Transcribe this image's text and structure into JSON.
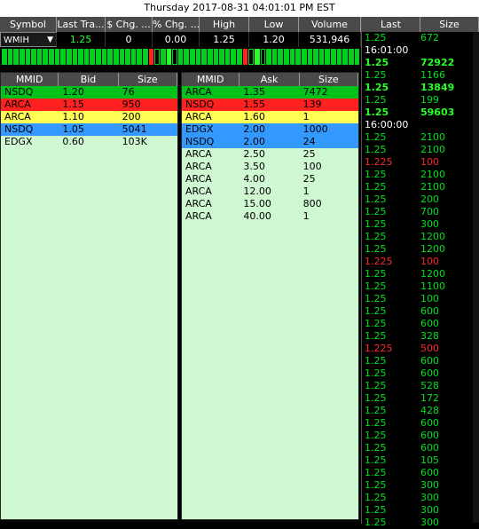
{
  "window_title": "Thursday 2017-08-31 04:01:01 PM EST",
  "quote": {
    "headers": [
      "Symbol",
      "Last Tra...",
      "$ Chg. ...",
      "% Chg. ...",
      "High",
      "Low",
      "Volume"
    ],
    "symbol": "WMIH",
    "last": "1.25",
    "chg": "0",
    "pct_chg": "0.00",
    "high": "1.25",
    "low": "1.20",
    "volume": "531,946"
  },
  "ticks": [
    "g",
    "g",
    "g",
    "g",
    "g",
    "g",
    "g",
    "g",
    "g",
    "g",
    "g",
    "g",
    "g",
    "g",
    "g",
    "g",
    "g",
    "g",
    "g",
    "g",
    "g",
    "g",
    "g",
    "g",
    "g",
    "r",
    "e",
    "g",
    "lg",
    "e",
    "g",
    "g",
    "g",
    "g",
    "g",
    "g",
    "g",
    "g",
    "g",
    "g",
    "g",
    "r",
    "e",
    "lg",
    "e",
    "g",
    "g",
    "g",
    "g",
    "g",
    "g",
    "g",
    "g",
    "g",
    "g",
    "g",
    "g",
    "g",
    "g",
    "g",
    "g"
  ],
  "bid_book": {
    "headers": [
      "MMID",
      "Bid",
      "Size"
    ],
    "rows": [
      {
        "mmid": "NSDQ",
        "price": "1.20",
        "size": "76",
        "bg": "#00c21a"
      },
      {
        "mmid": "ARCA",
        "price": "1.15",
        "size": "950",
        "bg": "#ff2020"
      },
      {
        "mmid": "ARCA",
        "price": "1.10",
        "size": "200",
        "bg": "#ffff55"
      },
      {
        "mmid": "NSDQ",
        "price": "1.05",
        "size": "5041",
        "bg": "#3399ff"
      },
      {
        "mmid": "EDGX",
        "price": "0.60",
        "size": "103K",
        "bg": "#cff7d2"
      }
    ]
  },
  "ask_book": {
    "headers": [
      "MMID",
      "Ask",
      "Size"
    ],
    "rows": [
      {
        "mmid": "ARCA",
        "price": "1.35",
        "size": "7472",
        "bg": "#00c21a"
      },
      {
        "mmid": "NSDQ",
        "price": "1.55",
        "size": "139",
        "bg": "#ff2020"
      },
      {
        "mmid": "ARCA",
        "price": "1.60",
        "size": "1",
        "bg": "#ffff55"
      },
      {
        "mmid": "EDGX",
        "price": "2.00",
        "size": "1000",
        "bg": "#3399ff"
      },
      {
        "mmid": "NSDQ",
        "price": "2.00",
        "size": "24",
        "bg": "#3399ff"
      },
      {
        "mmid": "ARCA",
        "price": "2.50",
        "size": "25",
        "bg": "#cff7d2"
      },
      {
        "mmid": "ARCA",
        "price": "3.50",
        "size": "100",
        "bg": "#cff7d2"
      },
      {
        "mmid": "ARCA",
        "price": "4.00",
        "size": "25",
        "bg": "#cff7d2"
      },
      {
        "mmid": "ARCA",
        "price": "12.00",
        "size": "1",
        "bg": "#cff7d2"
      },
      {
        "mmid": "ARCA",
        "price": "15.00",
        "size": "800",
        "bg": "#cff7d2"
      },
      {
        "mmid": "ARCA",
        "price": "40.00",
        "size": "1",
        "bg": "#cff7d2"
      }
    ]
  },
  "tape": {
    "headers": [
      "Last",
      "Size"
    ],
    "rows": [
      {
        "last": "1.25",
        "size": "672",
        "color": "#00e020",
        "bold": false
      },
      {
        "last": "16:01:00",
        "size": "",
        "color": "#ffffff",
        "bold": false
      },
      {
        "last": "1.25",
        "size": "72922",
        "color": "#28ff28",
        "bold": true
      },
      {
        "last": "1.25",
        "size": "1166",
        "color": "#00e020",
        "bold": false
      },
      {
        "last": "1.25",
        "size": "13849",
        "color": "#28ff28",
        "bold": true
      },
      {
        "last": "1.25",
        "size": "199",
        "color": "#00e020",
        "bold": false
      },
      {
        "last": "1.25",
        "size": "59603",
        "color": "#28ff28",
        "bold": true
      },
      {
        "last": "16:00:00",
        "size": "",
        "color": "#ffffff",
        "bold": false
      },
      {
        "last": "1.25",
        "size": "2100",
        "color": "#00e020",
        "bold": false
      },
      {
        "last": "1.25",
        "size": "2100",
        "color": "#00e020",
        "bold": false
      },
      {
        "last": "1.225",
        "size": "100",
        "color": "#ff2a2a",
        "bold": false
      },
      {
        "last": "1.25",
        "size": "2100",
        "color": "#00e020",
        "bold": false
      },
      {
        "last": "1.25",
        "size": "2100",
        "color": "#00e020",
        "bold": false
      },
      {
        "last": "1.25",
        "size": "200",
        "color": "#00e020",
        "bold": false
      },
      {
        "last": "1.25",
        "size": "700",
        "color": "#00e020",
        "bold": false
      },
      {
        "last": "1.25",
        "size": "300",
        "color": "#00e020",
        "bold": false
      },
      {
        "last": "1.25",
        "size": "1200",
        "color": "#00e020",
        "bold": false
      },
      {
        "last": "1.25",
        "size": "1200",
        "color": "#00e020",
        "bold": false
      },
      {
        "last": "1.225",
        "size": "100",
        "color": "#ff2a2a",
        "bold": false
      },
      {
        "last": "1.25",
        "size": "1200",
        "color": "#00e020",
        "bold": false
      },
      {
        "last": "1.25",
        "size": "1100",
        "color": "#00e020",
        "bold": false
      },
      {
        "last": "1.25",
        "size": "100",
        "color": "#00e020",
        "bold": false
      },
      {
        "last": "1.25",
        "size": "600",
        "color": "#00e020",
        "bold": false
      },
      {
        "last": "1.25",
        "size": "600",
        "color": "#00e020",
        "bold": false
      },
      {
        "last": "1.25",
        "size": "328",
        "color": "#00e020",
        "bold": false
      },
      {
        "last": "1.225",
        "size": "500",
        "color": "#ff2a2a",
        "bold": false
      },
      {
        "last": "1.25",
        "size": "600",
        "color": "#00e020",
        "bold": false
      },
      {
        "last": "1.25",
        "size": "600",
        "color": "#00e020",
        "bold": false
      },
      {
        "last": "1.25",
        "size": "528",
        "color": "#00e020",
        "bold": false
      },
      {
        "last": "1.25",
        "size": "172",
        "color": "#00e020",
        "bold": false
      },
      {
        "last": "1.25",
        "size": "428",
        "color": "#00e020",
        "bold": false
      },
      {
        "last": "1.25",
        "size": "600",
        "color": "#00e020",
        "bold": false
      },
      {
        "last": "1.25",
        "size": "600",
        "color": "#00e020",
        "bold": false
      },
      {
        "last": "1.25",
        "size": "600",
        "color": "#00e020",
        "bold": false
      },
      {
        "last": "1.25",
        "size": "105",
        "color": "#00e020",
        "bold": false
      },
      {
        "last": "1.25",
        "size": "600",
        "color": "#00e020",
        "bold": false
      },
      {
        "last": "1.25",
        "size": "300",
        "color": "#00e020",
        "bold": false
      },
      {
        "last": "1.25",
        "size": "300",
        "color": "#00e020",
        "bold": false
      },
      {
        "last": "1.25",
        "size": "300",
        "color": "#00e020",
        "bold": false
      },
      {
        "last": "1.25",
        "size": "300",
        "color": "#00e020",
        "bold": false
      }
    ]
  }
}
